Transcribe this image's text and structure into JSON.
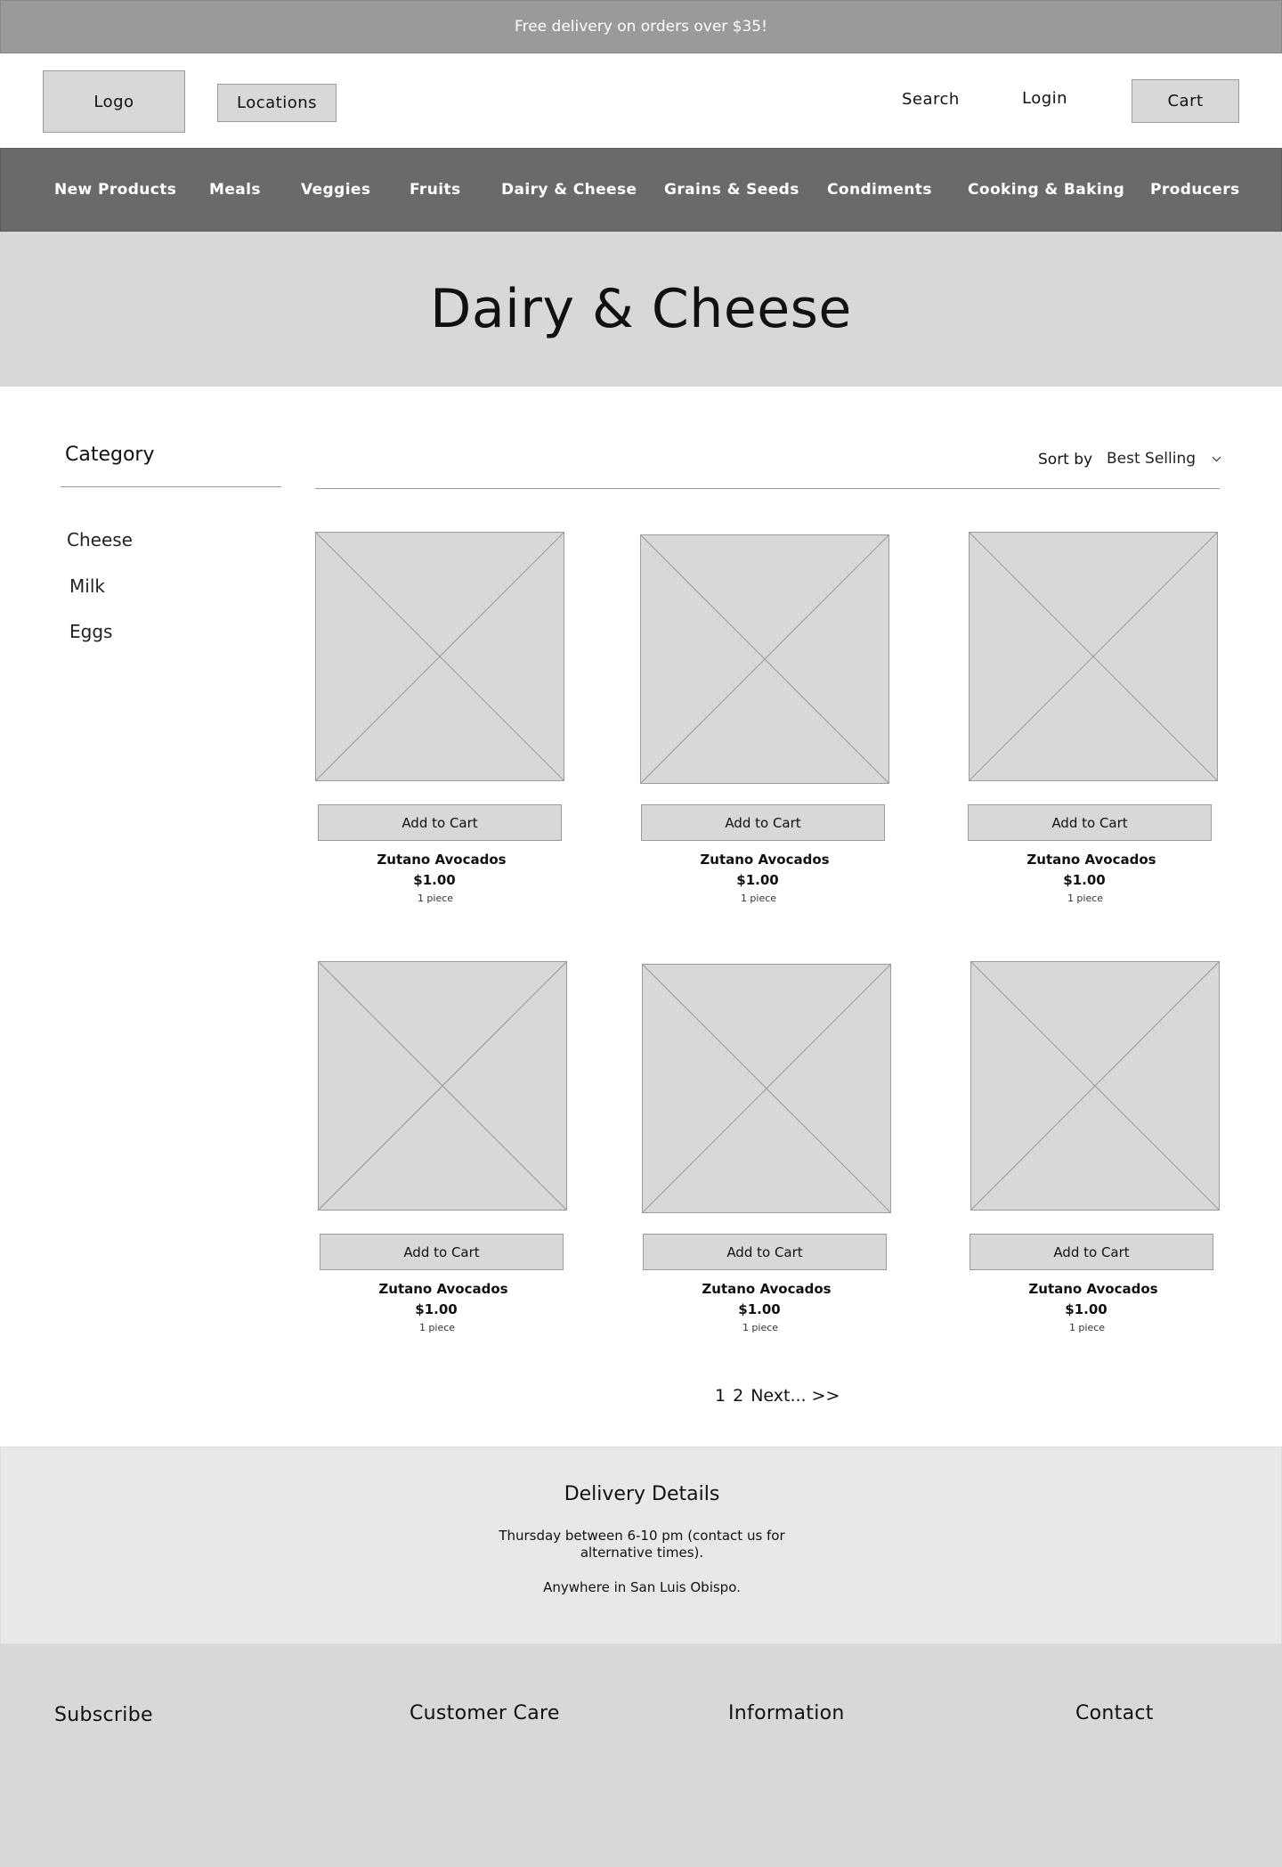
{
  "promo": {
    "text": "Free delivery on orders over $35!"
  },
  "header": {
    "logo_label": "Logo",
    "locations_label": "Locations",
    "search_label": "Search",
    "login_label": "Login",
    "cart_label": "Cart"
  },
  "nav": {
    "items": [
      {
        "label": "New Products"
      },
      {
        "label": "Meals"
      },
      {
        "label": "Veggies"
      },
      {
        "label": "Fruits"
      },
      {
        "label": "Dairy & Cheese"
      },
      {
        "label": "Grains & Seeds"
      },
      {
        "label": "Condiments"
      },
      {
        "label": "Cooking & Baking"
      },
      {
        "label": "Producers"
      }
    ]
  },
  "hero": {
    "title": "Dairy & Cheese"
  },
  "sidebar": {
    "title": "Category",
    "items": [
      {
        "label": "Cheese"
      },
      {
        "label": "Milk"
      },
      {
        "label": "Eggs"
      }
    ]
  },
  "sort": {
    "label": "Sort by",
    "selected": "Best Selling",
    "icon": "chevron-down-icon"
  },
  "products": [
    {
      "button": "Add to Cart",
      "name": "Zutano Avocados",
      "price": "$1.00",
      "unit": "1 piece"
    },
    {
      "button": "Add to Cart",
      "name": "Zutano Avocados",
      "price": "$1.00",
      "unit": "1 piece"
    },
    {
      "button": "Add to Cart",
      "name": "Zutano Avocados",
      "price": "$1.00",
      "unit": "1 piece"
    },
    {
      "button": "Add to Cart",
      "name": "Zutano Avocados",
      "price": "$1.00",
      "unit": "1 piece"
    },
    {
      "button": "Add to Cart",
      "name": "Zutano Avocados",
      "price": "$1.00",
      "unit": "1 piece"
    },
    {
      "button": "Add to Cart",
      "name": "Zutano Avocados",
      "price": "$1.00",
      "unit": "1 piece"
    }
  ],
  "pagination": {
    "pages": [
      "1",
      "2"
    ],
    "next": "Next... >>"
  },
  "delivery": {
    "title": "Delivery Details",
    "schedule": "Thursday between 6-10 pm (contact us for alternative times).",
    "area": "Anywhere in San Luis Obispo."
  },
  "footer": {
    "subscribe": "Subscribe",
    "customer_care": "Customer Care",
    "information": "Information",
    "contact": "Contact"
  }
}
